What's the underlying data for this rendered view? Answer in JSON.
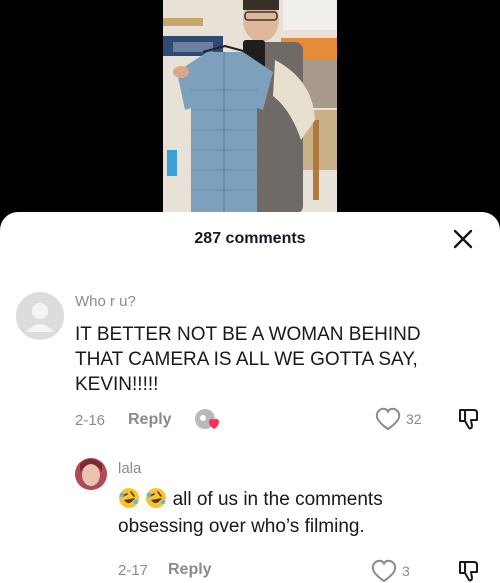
{
  "sheet": {
    "comment_count_label": "287 comments"
  },
  "comments": [
    {
      "username": "Who r u?",
      "text_lines": [
        "IT BETTER NOT BE A WOMAN BEHIND",
        "THAT CAMERA IS ALL WE GOTTA SAY,",
        "KEVIN!!!!!"
      ],
      "date": "2-16",
      "reply_label": "Reply",
      "likes": "32"
    },
    {
      "username": "lala",
      "text_line1": "all of us in the comments",
      "text_line2": "obsessing over who’s filming.",
      "date": "2-17",
      "reply_label": "Reply",
      "likes": "3"
    }
  ],
  "icons": {
    "close": "close-icon",
    "like": "heart-outline-icon",
    "dislike": "thumbs-down-icon",
    "emoji": "rolling-on-floor-laughing-emoji",
    "creator_liked": "creator-liked-heart-icon"
  },
  "colors": {
    "primary_text": "#161823",
    "secondary_text": "#8a8b91",
    "liked_heart": "#fe2c55"
  }
}
